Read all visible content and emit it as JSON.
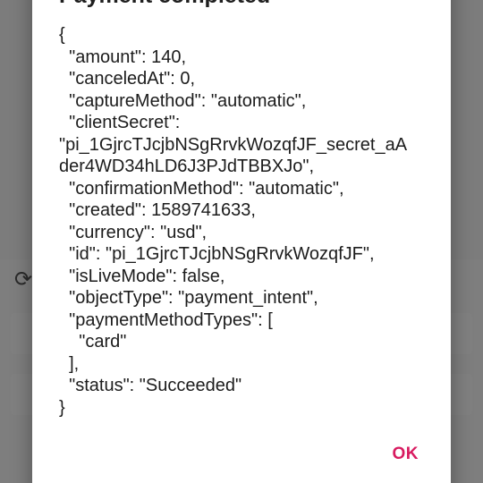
{
  "dialog": {
    "title": "Payment completed",
    "lines": [
      "{",
      "  \"amount\": 140,",
      "  \"canceledAt\": 0,",
      "  \"captureMethod\": \"automatic\",",
      "  \"clientSecret\":",
      "\"pi_1GjrcTJcjbNSgRrvkWozqfJF_secret_aA",
      "der4WD34hLD6J3PJdTBBXJo\",",
      "  \"confirmationMethod\": \"automatic\",",
      "  \"created\": 1589741633,",
      "  \"currency\": \"usd\",",
      "  \"id\": \"pi_1GjrcTJcjbNSgRrvkWozqfJF\",",
      "  \"isLiveMode\": false,",
      "  \"objectType\": \"payment_intent\",",
      "  \"paymentMethodTypes\": [",
      "    \"card\"",
      "  ],",
      "  \"status\": \"Succeeded\"",
      "}"
    ],
    "ok_label": "OK"
  },
  "colors": {
    "accent": "#d81b60",
    "scrim": "#7a7a7a",
    "dialog_bg": "#ffffff"
  }
}
